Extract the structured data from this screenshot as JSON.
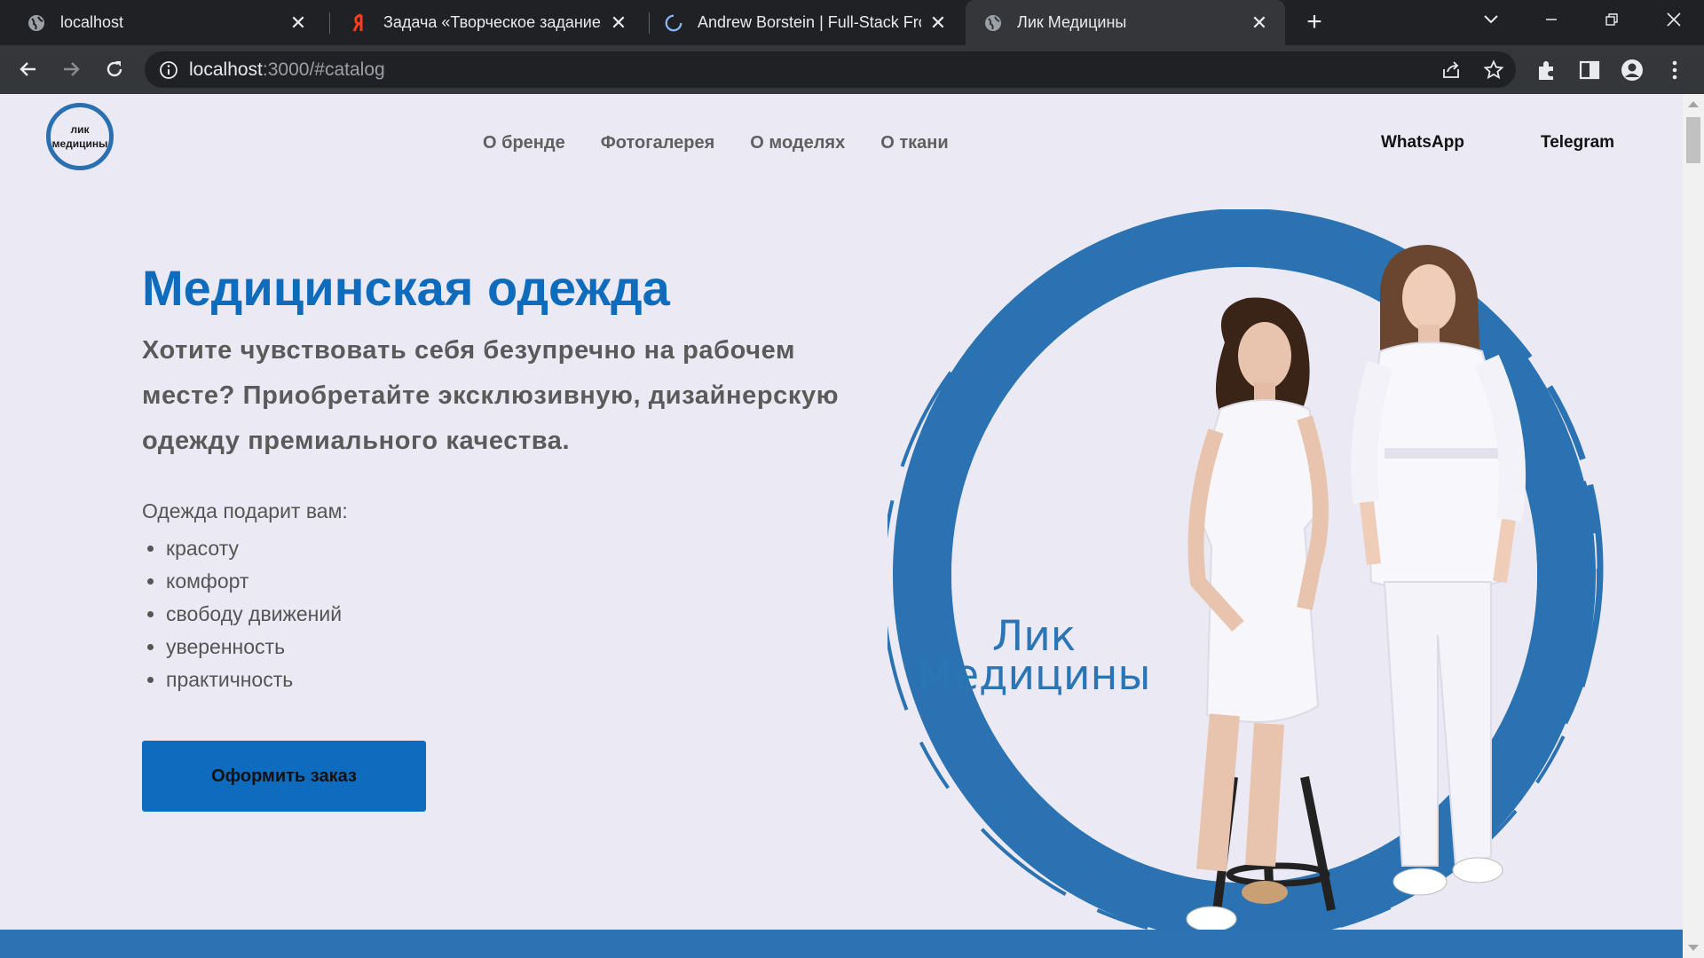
{
  "browser": {
    "tabs": [
      {
        "title": "localhost",
        "favicon": "globe-icon",
        "active": false
      },
      {
        "title": "Задача «Творческое задание» –",
        "favicon": "yandex-icon",
        "active": false
      },
      {
        "title": "Andrew Borstein | Full-Stack Fron",
        "favicon": "loading-spinner-icon",
        "active": false
      },
      {
        "title": "Лик Медицины",
        "favicon": "globe-icon",
        "active": true
      }
    ],
    "address": {
      "host": "localhost",
      "path": ":3000/#catalog"
    },
    "icons": [
      "back-icon",
      "forward-icon",
      "reload-icon",
      "info-icon",
      "share-icon",
      "star-icon",
      "extensions-icon",
      "side-panel-icon",
      "profile-icon",
      "menu-icon",
      "tab-search-icon",
      "minimize-icon",
      "restore-icon",
      "close-window-icon"
    ],
    "close_glyph": "✕",
    "newtab_glyph": "+"
  },
  "site": {
    "logo": {
      "line1": "лик",
      "line2": "медицины"
    },
    "nav": [
      "О бренде",
      "Фотогалерея",
      "О моделях",
      "О ткани"
    ],
    "contacts": {
      "whatsapp": "WhatsApp",
      "telegram": "Telegram"
    },
    "hero": {
      "title": "Медицинская одежда",
      "subtitle": "Хотите чувствовать себя безупречно на рабочем месте? Приобретайте эксклюзивную, дизайнерскую одежду премиального качества.",
      "benefits_title": "Одежда подарит вам:",
      "benefits": [
        "красоту",
        "комфорт",
        "свободу движений",
        "уверенность",
        "практичность"
      ],
      "order_button": "Оформить заказ"
    },
    "brand_art": {
      "line1": "Лик",
      "line2": "Медицины"
    },
    "colors": {
      "accent": "#0f6cbd",
      "ring": "#2a6fb0",
      "background": "#ebe9f3",
      "footer": "#2d73b3"
    }
  }
}
